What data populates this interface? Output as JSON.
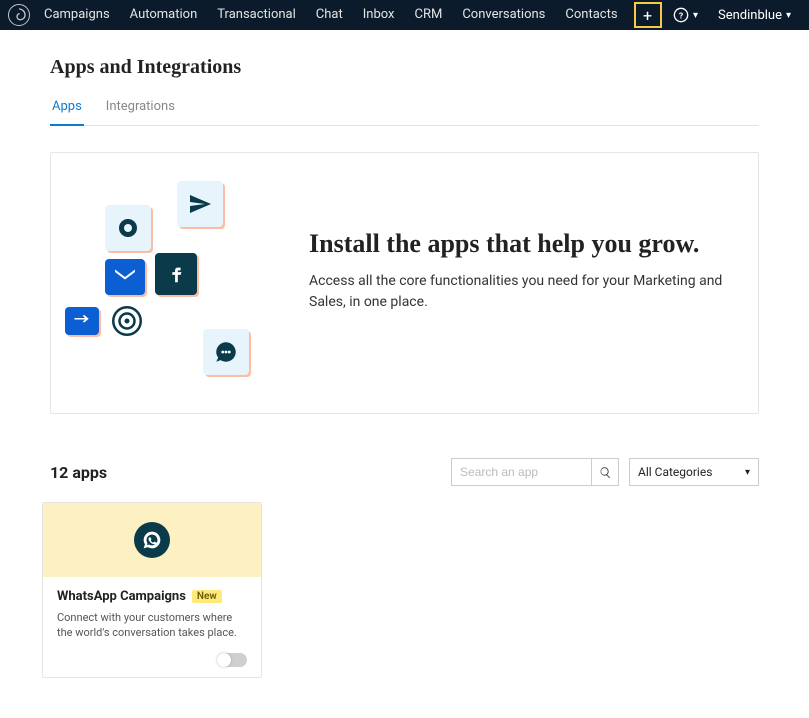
{
  "topnav": {
    "items": [
      "Campaigns",
      "Automation",
      "Transactional",
      "Chat",
      "Inbox",
      "CRM",
      "Conversations",
      "Contacts"
    ],
    "account_label": "Sendinblue"
  },
  "page": {
    "title": "Apps and Integrations"
  },
  "tabs": {
    "apps": "Apps",
    "integrations": "Integrations"
  },
  "hero": {
    "title": "Install the apps that help you grow.",
    "subtitle": "Access all the core functionalities you need for your Marketing and Sales, in one place."
  },
  "apps_bar": {
    "count_label": "12 apps",
    "search_placeholder": "Search an app",
    "category_label": "All Categories"
  },
  "cards": [
    {
      "title": "WhatsApp Campaigns",
      "badge": "New",
      "desc": "Connect with your customers where the world's conversation takes place."
    }
  ]
}
